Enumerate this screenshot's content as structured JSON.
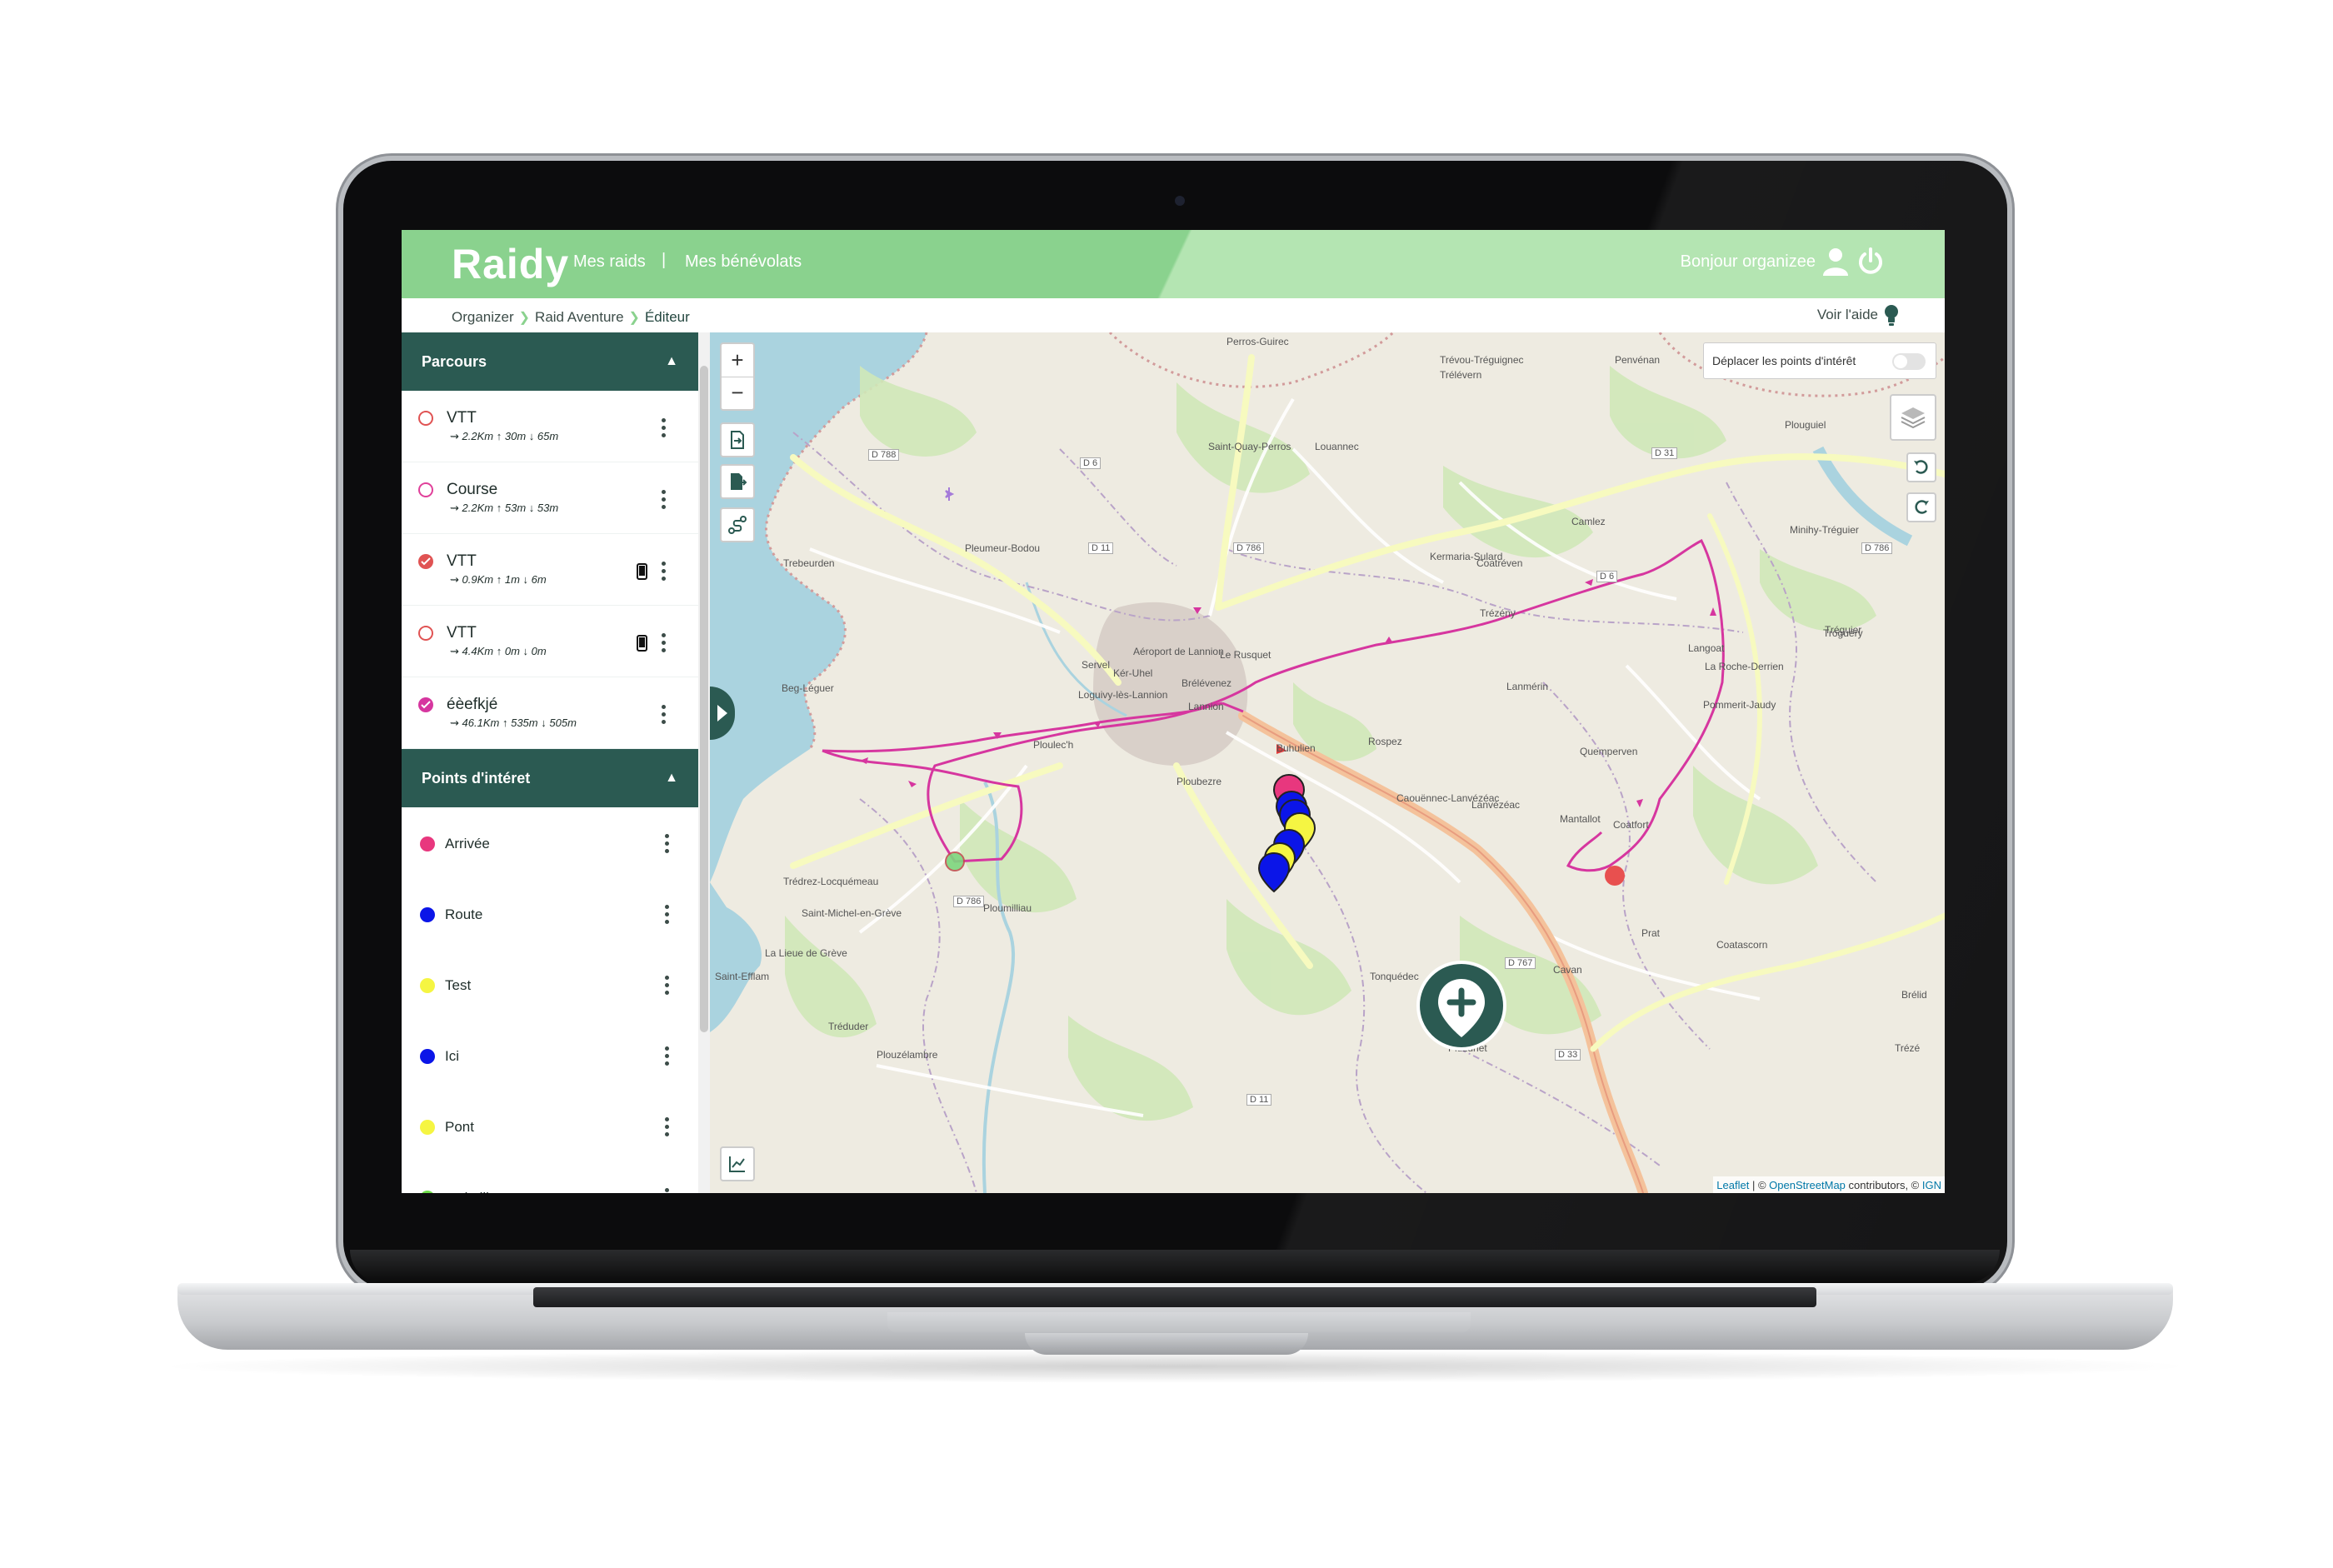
{
  "header": {
    "logo": "Raidy",
    "nav_raids": "Mes raids",
    "nav_separator": "|",
    "nav_volunteers": "Mes bénévolats",
    "greeting": "Bonjour organizee",
    "user_icon": "user-icon",
    "power_icon": "power-icon"
  },
  "breadcrumb": {
    "items": [
      "Organizer",
      "Raid Aventure",
      "Éditeur"
    ],
    "help_label": "Voir l'aide",
    "help_icon": "lightbulb-icon"
  },
  "sidebar": {
    "routes_title": "Parcours",
    "routes": [
      {
        "name": "VTT",
        "distance": "2.2Km",
        "up": "30m",
        "down": "65m",
        "color": "#e05353",
        "checked": false,
        "phone": false
      },
      {
        "name": "Course",
        "distance": "2.2Km",
        "up": "53m",
        "down": "53m",
        "color": "#e0409a",
        "checked": false,
        "phone": false
      },
      {
        "name": "VTT",
        "distance": "0.9Km",
        "up": "1m",
        "down": "6m",
        "color": "#e05353",
        "checked": true,
        "phone": true
      },
      {
        "name": "VTT",
        "distance": "4.4Km",
        "up": "0m",
        "down": "0m",
        "color": "#e05353",
        "checked": false,
        "phone": true
      },
      {
        "name": "éèefkjé",
        "distance": "46.1Km",
        "up": "535m",
        "down": "505m",
        "color": "#d6369f",
        "checked": true,
        "phone": false
      }
    ],
    "poi_title": "Points d'intéret",
    "pois": [
      {
        "name": "Arrivée",
        "color": "#e8377e"
      },
      {
        "name": "Route",
        "color": "#0b15e8"
      },
      {
        "name": "Test",
        "color": "#f5f542"
      },
      {
        "name": "Ici",
        "color": "#0b15e8"
      },
      {
        "name": "Pont",
        "color": "#f5f542"
      },
      {
        "name": "ravitaillement",
        "color": "#6fdd4a"
      }
    ]
  },
  "map": {
    "move_poi_label": "Déplacer les points d'intérêt",
    "move_poi_enabled": false,
    "attribution_leaflet": "Leaflet",
    "attribution_sep": " | © ",
    "attribution_osm": "OpenStreetMap",
    "attribution_mid": " contributors, © ",
    "attribution_ign": "IGN",
    "route_color": "#d6369f",
    "labels": [
      "Perros-Guirec",
      "Trévou-Tréguignec",
      "Trélévern",
      "Penvénan",
      "Saint-Quay-Perros",
      "Louannec",
      "Pleumeur-Bodou",
      "Trebeurden",
      "Kermaria-Sulard",
      "Coatréven",
      "Camlez",
      "Minihy-Tréguier",
      "Plouguiel",
      "Tréguier",
      "Trézény",
      "Langoat",
      "La Roche-Derrien",
      "Troguéry",
      "Aéroport de Lannion",
      "Le Rusquet",
      "Servel",
      "Kér-Uhel",
      "Brélévenez",
      "Lannion",
      "Lanmérin",
      "Pommerit-Jaudy",
      "Beg-Léguer",
      "Loguivy-lès-Lannion",
      "Rospez",
      "Quemperven",
      "Ploulec'h",
      "Caouënnec-Lanvézéac",
      "Lanvézéac",
      "Ploubezre",
      "Mantallot",
      "Coatfort",
      "Trédrez-Locquémeau",
      "Saint-Michel-en-Grève",
      "Ploumilliau",
      "Prat",
      "Coatascorn",
      "La Lieue de Grève",
      "Saint-Efflam",
      "Tonquédec",
      "Cavan",
      "Tréduder",
      "Plouzélambre",
      "Pluzunet",
      "Trézé",
      "Brélid",
      "Buhulien"
    ],
    "roads": [
      "D 788",
      "D 6",
      "D 11",
      "D 786",
      "D 31",
      "D 786",
      "D 767",
      "D 33",
      "D 11",
      "D 786",
      "D 6"
    ]
  }
}
